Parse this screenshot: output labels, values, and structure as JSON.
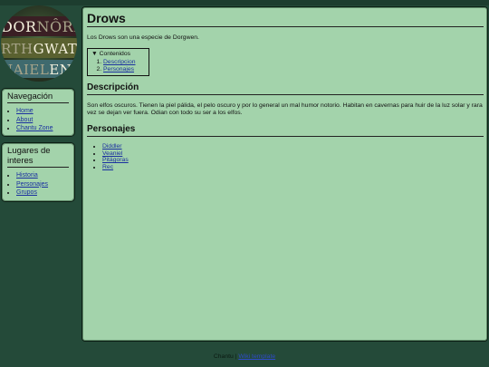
{
  "logo": {
    "line1_main": "DOR",
    "line1_dim": "NÔRI",
    "line2_dim": "RTH",
    "line2_main": "GWATH",
    "line3_dim": "NAIEL",
    "line3_main": "EN-"
  },
  "sidebar": {
    "nav": {
      "title": "Navegación",
      "items": [
        {
          "label": "Home"
        },
        {
          "label": "About"
        },
        {
          "label": "Chantu Zone"
        }
      ]
    },
    "places": {
      "title": "Lugares de interes",
      "items": [
        {
          "label": "Historia"
        },
        {
          "label": "Personajes"
        },
        {
          "label": "Grupos"
        }
      ]
    }
  },
  "page": {
    "title": "Drows",
    "intro": "Los Drows son una especie de Dorgwen.",
    "toc": {
      "title": "▼ Contenidos",
      "items": [
        {
          "label": "Descripcion"
        },
        {
          "label": "Personajes"
        }
      ]
    },
    "sections": {
      "description": {
        "heading": "Descripción",
        "text": "Son elfos oscuros. Tienen la piel pálida, el pelo oscuro y por lo general un mal humor notorio. Habitan en cavernas para huir de la luz solar y rara vez se dejan ver fuera. Odian con todo su ser a los elfos."
      },
      "characters": {
        "heading": "Personajes",
        "items": [
          {
            "label": "Diddler"
          },
          {
            "label": "Veaniel"
          },
          {
            "label": "Pitágoras"
          },
          {
            "label": "Rec"
          }
        ]
      }
    }
  },
  "footer": {
    "text": "Chantu | ",
    "link": "Wiki template"
  }
}
